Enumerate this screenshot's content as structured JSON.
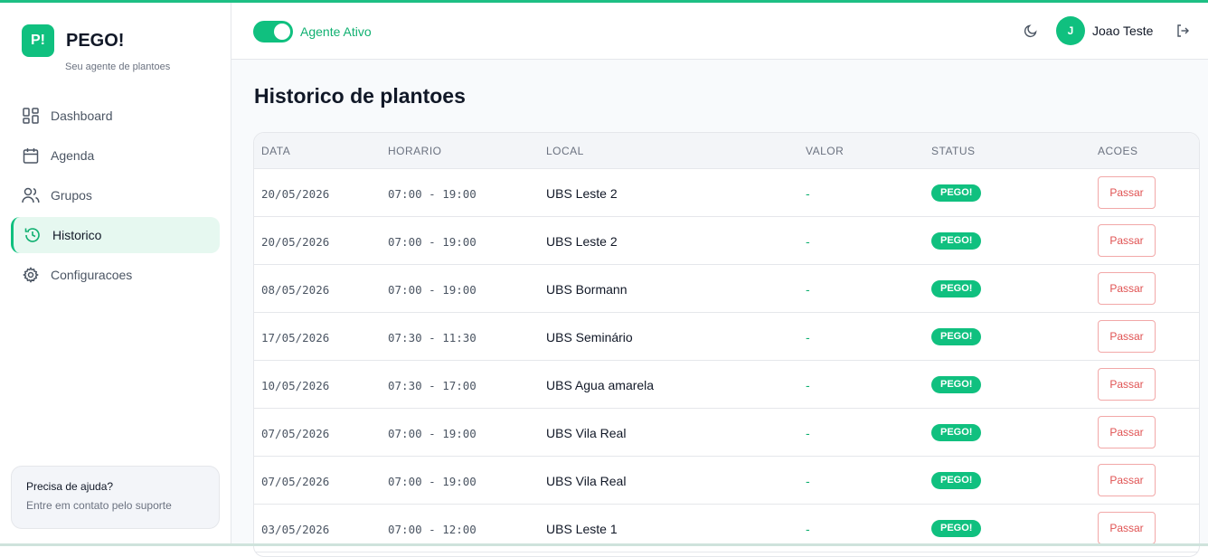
{
  "brand": {
    "logo": "P!",
    "name": "PEGO!",
    "tagline": "Seu agente de plantoes"
  },
  "sidebar": {
    "items": [
      {
        "label": "Dashboard",
        "icon": "dashboard-icon"
      },
      {
        "label": "Agenda",
        "icon": "calendar-icon"
      },
      {
        "label": "Grupos",
        "icon": "users-icon"
      },
      {
        "label": "Historico",
        "icon": "history-icon",
        "active": true
      },
      {
        "label": "Configuracoes",
        "icon": "gear-icon"
      }
    ],
    "help": {
      "title": "Precisa de ajuda?",
      "subtitle": "Entre em contato pelo suporte"
    }
  },
  "header": {
    "agent_toggle": {
      "label": "Agente Ativo",
      "on": true
    },
    "theme_icon": "moon-icon",
    "user": {
      "initial": "J",
      "name": "Joao Teste"
    },
    "logout_icon": "logout-icon"
  },
  "page": {
    "title": "Historico de plantoes"
  },
  "table": {
    "columns": [
      "DATA",
      "HORARIO",
      "LOCAL",
      "VALOR",
      "STATUS",
      "ACOES"
    ],
    "rows": [
      {
        "data": "20/05/2026",
        "horario": "07:00 - 19:00",
        "local": "UBS Leste 2",
        "valor": "-",
        "status": "PEGO!",
        "acao": "Passar"
      },
      {
        "data": "20/05/2026",
        "horario": "07:00 - 19:00",
        "local": "UBS Leste 2",
        "valor": "-",
        "status": "PEGO!",
        "acao": "Passar"
      },
      {
        "data": "08/05/2026",
        "horario": "07:00 - 19:00",
        "local": "UBS Bormann",
        "valor": "-",
        "status": "PEGO!",
        "acao": "Passar"
      },
      {
        "data": "17/05/2026",
        "horario": "07:30 - 11:30",
        "local": "UBS Seminário",
        "valor": "-",
        "status": "PEGO!",
        "acao": "Passar"
      },
      {
        "data": "10/05/2026",
        "horario": "07:30 - 17:00",
        "local": "UBS Agua amarela",
        "valor": "-",
        "status": "PEGO!",
        "acao": "Passar"
      },
      {
        "data": "07/05/2026",
        "horario": "07:00 - 19:00",
        "local": "UBS Vila Real",
        "valor": "-",
        "status": "PEGO!",
        "acao": "Passar"
      },
      {
        "data": "07/05/2026",
        "horario": "07:00 - 19:00",
        "local": "UBS Vila Real",
        "valor": "-",
        "status": "PEGO!",
        "acao": "Passar"
      },
      {
        "data": "03/05/2026",
        "horario": "07:00 - 12:00",
        "local": "UBS Leste 1",
        "valor": "-",
        "status": "PEGO!",
        "acao": "Passar"
      }
    ]
  },
  "colors": {
    "accent": "#10c07f",
    "danger": "#e05252"
  }
}
